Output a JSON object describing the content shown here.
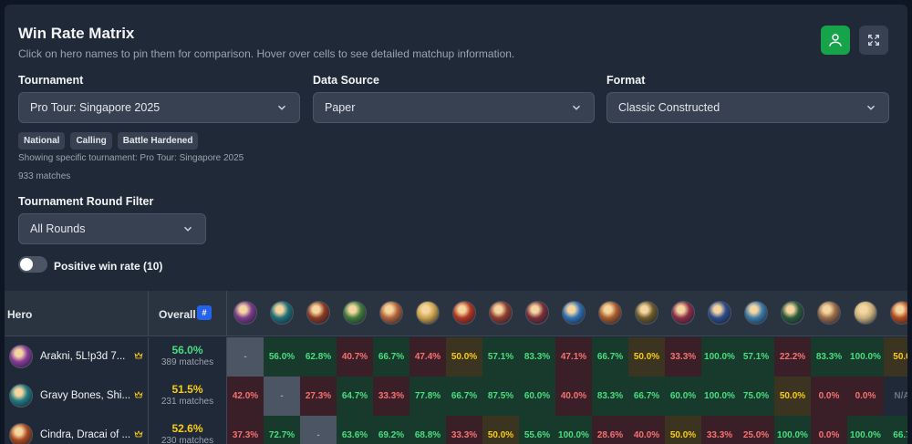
{
  "header": {
    "title": "Win Rate Matrix",
    "subtitle": "Click on hero names to pin them for comparison. Hover over cells to see detailed matchup information.",
    "icons": {
      "user": "user-icon",
      "expand": "expand-icon"
    }
  },
  "filters": {
    "tournament_label": "Tournament",
    "tournament_value": "Pro Tour: Singapore 2025",
    "source_label": "Data Source",
    "source_value": "Paper",
    "format_label": "Format",
    "format_value": "Classic Constructed"
  },
  "chips": [
    "National",
    "Calling",
    "Battle Hardened"
  ],
  "notes": {
    "showing": "Showing specific tournament: Pro Tour: Singapore 2025",
    "matches": "933 matches"
  },
  "round_filter": {
    "label": "Tournament Round Filter",
    "value": "All Rounds"
  },
  "toggle": {
    "label": "Positive win rate (10)",
    "on": false
  },
  "matrix": {
    "hero_header": "Hero",
    "overall_header": "Overall",
    "sort_badge": "#",
    "column_colors": [
      "#7c3a8c",
      "#1f6f78",
      "#8b3a22",
      "#3f7a3a",
      "#b0623a",
      "#c9a24a",
      "#b2361f",
      "#8e3b2f",
      "#7a2e3a",
      "#2f6fb3",
      "#a85a2a",
      "#6b5a2a",
      "#8a2d45",
      "#2c4c8a",
      "#3a7aa8",
      "#2a5a3a",
      "#9a6a4a",
      "#c9b07a",
      "#b24a1f"
    ],
    "rows": [
      {
        "name": "Arakni, 5L!p3d 7...",
        "avatar_color": "#8a3a9a",
        "overall": "56.0%",
        "overall_color": "#4ade80",
        "matches": "389 matches",
        "cells": [
          {
            "v": "-",
            "t": "self"
          },
          {
            "v": "56.0%",
            "t": "hi"
          },
          {
            "v": "62.8%",
            "t": "hi"
          },
          {
            "v": "40.7%",
            "t": "lo"
          },
          {
            "v": "66.7%",
            "t": "hi"
          },
          {
            "v": "47.4%",
            "t": "lo"
          },
          {
            "v": "50.0%",
            "t": "mid"
          },
          {
            "v": "57.1%",
            "t": "hi"
          },
          {
            "v": "83.3%",
            "t": "hi"
          },
          {
            "v": "47.1%",
            "t": "lo"
          },
          {
            "v": "66.7%",
            "t": "hi"
          },
          {
            "v": "50.0%",
            "t": "mid"
          },
          {
            "v": "33.3%",
            "t": "lo"
          },
          {
            "v": "100.0%",
            "t": "hi"
          },
          {
            "v": "57.1%",
            "t": "hi"
          },
          {
            "v": "22.2%",
            "t": "lo"
          },
          {
            "v": "83.3%",
            "t": "hi"
          },
          {
            "v": "100.0%",
            "t": "hi"
          },
          {
            "v": "50.0",
            "t": "mid"
          }
        ]
      },
      {
        "name": "Gravy Bones, Shi...",
        "avatar_color": "#1f7a80",
        "overall": "51.5%",
        "overall_color": "#facc15",
        "matches": "231 matches",
        "cells": [
          {
            "v": "42.0%",
            "t": "lo"
          },
          {
            "v": "-",
            "t": "self"
          },
          {
            "v": "27.3%",
            "t": "lo"
          },
          {
            "v": "64.7%",
            "t": "hi"
          },
          {
            "v": "33.3%",
            "t": "lo"
          },
          {
            "v": "77.8%",
            "t": "hi"
          },
          {
            "v": "66.7%",
            "t": "hi"
          },
          {
            "v": "87.5%",
            "t": "hi"
          },
          {
            "v": "60.0%",
            "t": "hi"
          },
          {
            "v": "40.0%",
            "t": "lo"
          },
          {
            "v": "83.3%",
            "t": "hi"
          },
          {
            "v": "66.7%",
            "t": "hi"
          },
          {
            "v": "60.0%",
            "t": "hi"
          },
          {
            "v": "100.0%",
            "t": "hi"
          },
          {
            "v": "75.0%",
            "t": "hi"
          },
          {
            "v": "50.0%",
            "t": "mid"
          },
          {
            "v": "0.0%",
            "t": "lo"
          },
          {
            "v": "0.0%",
            "t": "lo"
          },
          {
            "v": "N/A",
            "t": "na"
          }
        ]
      },
      {
        "name": "Cindra, Dracai of ...",
        "avatar_color": "#a8481f",
        "overall": "52.6%",
        "overall_color": "#facc15",
        "matches": "230 matches",
        "cells": [
          {
            "v": "37.3%",
            "t": "lo"
          },
          {
            "v": "72.7%",
            "t": "hi"
          },
          {
            "v": "-",
            "t": "self"
          },
          {
            "v": "63.6%",
            "t": "hi"
          },
          {
            "v": "69.2%",
            "t": "hi"
          },
          {
            "v": "68.8%",
            "t": "hi"
          },
          {
            "v": "33.3%",
            "t": "lo"
          },
          {
            "v": "50.0%",
            "t": "mid"
          },
          {
            "v": "55.6%",
            "t": "hi"
          },
          {
            "v": "100.0%",
            "t": "hi"
          },
          {
            "v": "28.6%",
            "t": "lo"
          },
          {
            "v": "40.0%",
            "t": "lo"
          },
          {
            "v": "50.0%",
            "t": "mid"
          },
          {
            "v": "33.3%",
            "t": "lo"
          },
          {
            "v": "25.0%",
            "t": "lo"
          },
          {
            "v": "100.0%",
            "t": "hi"
          },
          {
            "v": "0.0%",
            "t": "lo"
          },
          {
            "v": "100.0%",
            "t": "hi"
          },
          {
            "v": "66.7",
            "t": "hi"
          }
        ]
      }
    ]
  }
}
